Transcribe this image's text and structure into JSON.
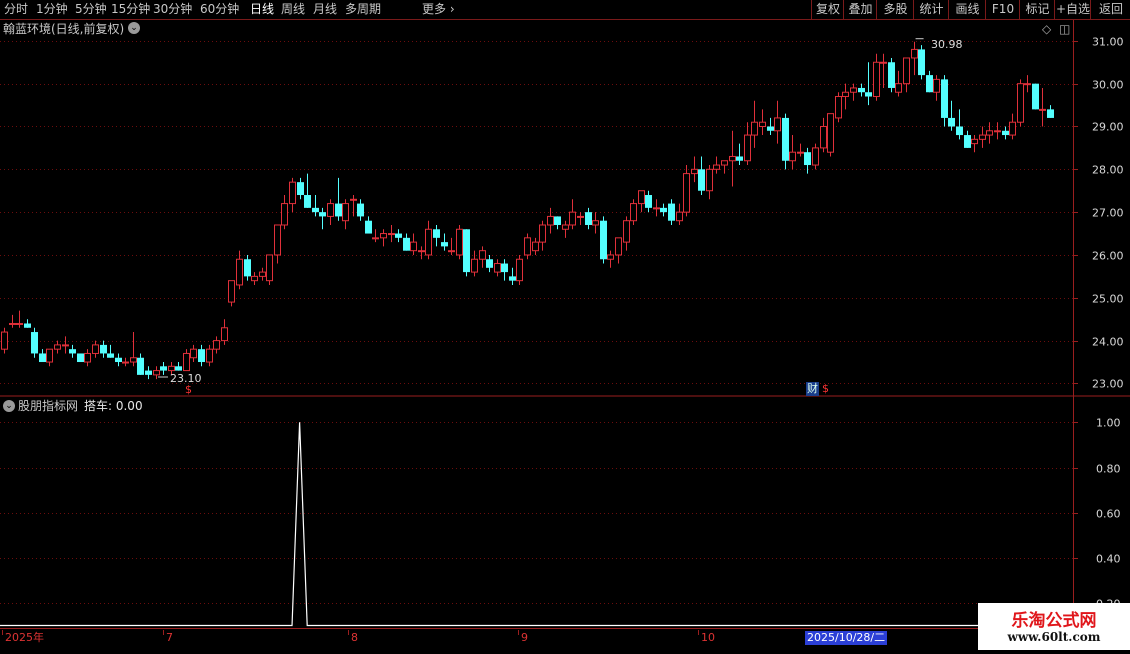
{
  "toolbar": {
    "periods": [
      "分时",
      "1分钟",
      "5分钟",
      "15分钟",
      "30分钟",
      "60分钟",
      "日线",
      "周线",
      "月线",
      "多周期"
    ],
    "active_period": "日线",
    "more_label": "更多",
    "right_buttons": [
      "复权",
      "叠加",
      "多股",
      "统计",
      "画线",
      "F10",
      "标记",
      "+自选",
      "返回"
    ]
  },
  "main_chart": {
    "title": "翰蓝环境(日线,前复权)",
    "high_label": "30.98",
    "low_label": "23.10",
    "event_marker_cai": "财",
    "event_marker_dollar": "$",
    "event_marker_dollar_left": "$"
  },
  "indicator": {
    "title": "股朋指标网",
    "value_text": "搭车: 0.00"
  },
  "time_axis": {
    "labels": [
      "2025年",
      "7",
      "8",
      "9",
      "10"
    ],
    "selected_date": "2025/10/28/二"
  },
  "watermark": {
    "line1": "乐淘公式网",
    "line2": "www.60lt.com"
  },
  "colors": {
    "up": "#e0303a",
    "down": "#54ffff",
    "grid": "#6b0d0d",
    "frame": "#9a1e1e",
    "axis_text": "#d8d8d8",
    "indicator_line": "#ffffff"
  },
  "chart_data": [
    {
      "type": "candlestick",
      "title": "翰蓝环境(日线,前复权)",
      "ylim": [
        22.8,
        31.3
      ],
      "y_ticks": [
        23.0,
        24.0,
        25.0,
        26.0,
        27.0,
        28.0,
        29.0,
        30.0,
        31.0
      ],
      "annotations": [
        {
          "label": "30.98",
          "kind": "high"
        },
        {
          "label": "23.10",
          "kind": "low"
        }
      ],
      "ohlc": [
        [
          23.8,
          24.3,
          23.7,
          24.2
        ],
        [
          24.4,
          24.6,
          24.3,
          24.4
        ],
        [
          24.4,
          24.7,
          24.3,
          24.4
        ],
        [
          24.4,
          24.5,
          24.3,
          24.3
        ],
        [
          24.2,
          24.3,
          23.6,
          23.7
        ],
        [
          23.7,
          23.8,
          23.5,
          23.5
        ],
        [
          23.5,
          23.8,
          23.4,
          23.8
        ],
        [
          23.8,
          24.0,
          23.7,
          23.9
        ],
        [
          23.9,
          24.1,
          23.7,
          23.9
        ],
        [
          23.8,
          23.9,
          23.6,
          23.7
        ],
        [
          23.7,
          23.7,
          23.5,
          23.5
        ],
        [
          23.5,
          23.8,
          23.4,
          23.7
        ],
        [
          23.7,
          24.0,
          23.6,
          23.9
        ],
        [
          23.9,
          24.0,
          23.6,
          23.7
        ],
        [
          23.7,
          23.9,
          23.6,
          23.6
        ],
        [
          23.6,
          23.7,
          23.4,
          23.5
        ],
        [
          23.5,
          23.6,
          23.4,
          23.5
        ],
        [
          23.5,
          24.2,
          23.4,
          23.6
        ],
        [
          23.6,
          23.7,
          23.2,
          23.2
        ],
        [
          23.3,
          23.4,
          23.1,
          23.2
        ],
        [
          23.2,
          23.4,
          23.1,
          23.3
        ],
        [
          23.4,
          23.5,
          23.2,
          23.3
        ],
        [
          23.3,
          23.5,
          23.2,
          23.4
        ],
        [
          23.4,
          23.5,
          23.3,
          23.3
        ],
        [
          23.3,
          23.8,
          23.3,
          23.7
        ],
        [
          23.6,
          23.9,
          23.5,
          23.8
        ],
        [
          23.8,
          23.9,
          23.4,
          23.5
        ],
        [
          23.5,
          23.9,
          23.4,
          23.8
        ],
        [
          23.8,
          24.1,
          23.7,
          24.0
        ],
        [
          24.0,
          24.5,
          23.9,
          24.3
        ],
        [
          24.9,
          25.4,
          24.8,
          25.4
        ],
        [
          25.3,
          26.1,
          25.2,
          25.9
        ],
        [
          25.9,
          26.0,
          25.4,
          25.5
        ],
        [
          25.4,
          25.6,
          25.3,
          25.5
        ],
        [
          25.5,
          25.7,
          25.4,
          25.6
        ],
        [
          25.4,
          26.0,
          25.3,
          26.0
        ],
        [
          26.0,
          26.7,
          25.8,
          26.7
        ],
        [
          26.7,
          27.4,
          26.6,
          27.2
        ],
        [
          27.2,
          27.8,
          27.0,
          27.7
        ],
        [
          27.7,
          27.8,
          27.3,
          27.4
        ],
        [
          27.4,
          27.9,
          27.1,
          27.1
        ],
        [
          27.1,
          27.4,
          26.9,
          27.0
        ],
        [
          27.0,
          27.1,
          26.6,
          26.9
        ],
        [
          26.9,
          27.3,
          26.7,
          27.2
        ],
        [
          27.2,
          27.8,
          26.8,
          26.9
        ],
        [
          26.8,
          27.3,
          26.6,
          27.2
        ],
        [
          27.3,
          27.4,
          26.9,
          27.3
        ],
        [
          27.2,
          27.3,
          26.8,
          26.9
        ],
        [
          26.8,
          26.9,
          26.5,
          26.5
        ],
        [
          26.4,
          26.6,
          26.3,
          26.4
        ],
        [
          26.4,
          26.6,
          26.2,
          26.5
        ],
        [
          26.5,
          26.7,
          26.3,
          26.5
        ],
        [
          26.5,
          26.6,
          26.3,
          26.4
        ],
        [
          26.4,
          26.5,
          26.1,
          26.1
        ],
        [
          26.1,
          26.5,
          26.0,
          26.3
        ],
        [
          26.1,
          26.2,
          25.9,
          26.1
        ],
        [
          26.0,
          26.8,
          25.9,
          26.6
        ],
        [
          26.6,
          26.7,
          26.2,
          26.4
        ],
        [
          26.3,
          26.5,
          26.1,
          26.2
        ],
        [
          26.1,
          26.4,
          26.0,
          26.1
        ],
        [
          26.0,
          26.7,
          25.9,
          26.6
        ],
        [
          26.6,
          26.6,
          25.5,
          25.6
        ],
        [
          25.6,
          26.1,
          25.5,
          25.9
        ],
        [
          25.9,
          26.2,
          25.7,
          26.1
        ],
        [
          25.9,
          26.0,
          25.6,
          25.7
        ],
        [
          25.6,
          25.9,
          25.5,
          25.8
        ],
        [
          25.8,
          25.9,
          25.4,
          25.6
        ],
        [
          25.5,
          25.7,
          25.3,
          25.4
        ],
        [
          25.4,
          26.0,
          25.3,
          25.9
        ],
        [
          26.0,
          26.5,
          25.9,
          26.4
        ],
        [
          26.1,
          26.4,
          26.0,
          26.3
        ],
        [
          26.3,
          26.8,
          26.1,
          26.7
        ],
        [
          26.7,
          27.1,
          26.5,
          26.9
        ],
        [
          26.9,
          26.9,
          26.6,
          26.7
        ],
        [
          26.6,
          26.8,
          26.4,
          26.7
        ],
        [
          26.7,
          27.3,
          26.6,
          27.0
        ],
        [
          26.9,
          27.0,
          26.7,
          26.9
        ],
        [
          27.0,
          27.1,
          26.6,
          26.7
        ],
        [
          26.7,
          27.0,
          26.5,
          26.8
        ],
        [
          26.8,
          26.9,
          25.8,
          25.9
        ],
        [
          25.9,
          26.1,
          25.7,
          26.0
        ],
        [
          26.0,
          26.4,
          25.8,
          26.4
        ],
        [
          26.3,
          26.9,
          26.1,
          26.8
        ],
        [
          26.8,
          27.3,
          26.7,
          27.2
        ],
        [
          27.2,
          27.5,
          27.0,
          27.5
        ],
        [
          27.4,
          27.5,
          27.0,
          27.1
        ],
        [
          27.1,
          27.3,
          26.9,
          27.1
        ],
        [
          27.1,
          27.2,
          26.9,
          27.0
        ],
        [
          27.2,
          27.3,
          26.7,
          26.8
        ],
        [
          26.8,
          27.2,
          26.7,
          27.0
        ],
        [
          27.0,
          28.1,
          26.9,
          27.9
        ],
        [
          27.9,
          28.3,
          27.7,
          28.0
        ],
        [
          28.0,
          28.3,
          27.4,
          27.5
        ],
        [
          27.5,
          28.1,
          27.3,
          28.0
        ],
        [
          28.0,
          28.3,
          27.9,
          28.1
        ],
        [
          28.1,
          28.2,
          27.9,
          28.2
        ],
        [
          28.2,
          28.9,
          27.6,
          28.3
        ],
        [
          28.3,
          28.6,
          28.1,
          28.2
        ],
        [
          28.2,
          29.1,
          28.1,
          28.8
        ],
        [
          28.8,
          29.6,
          28.5,
          29.1
        ],
        [
          29.0,
          29.4,
          28.8,
          29.1
        ],
        [
          29.0,
          29.2,
          28.8,
          28.9
        ],
        [
          28.9,
          29.6,
          28.6,
          29.2
        ],
        [
          29.2,
          29.3,
          28.0,
          28.2
        ],
        [
          28.2,
          28.8,
          28.0,
          28.4
        ],
        [
          28.4,
          28.6,
          28.3,
          28.4
        ],
        [
          28.4,
          28.5,
          27.9,
          28.1
        ],
        [
          28.1,
          28.6,
          28.0,
          28.5
        ],
        [
          28.5,
          29.2,
          28.4,
          29.0
        ],
        [
          28.4,
          29.3,
          28.3,
          29.3
        ],
        [
          29.2,
          29.8,
          29.1,
          29.7
        ],
        [
          29.7,
          30.0,
          29.4,
          29.8
        ],
        [
          29.8,
          30.0,
          29.6,
          29.9
        ],
        [
          29.9,
          30.0,
          29.7,
          29.8
        ],
        [
          29.8,
          30.5,
          29.5,
          29.7
        ],
        [
          29.7,
          30.7,
          29.6,
          30.5
        ],
        [
          30.5,
          30.7,
          29.9,
          30.5
        ],
        [
          30.5,
          30.6,
          29.8,
          29.9
        ],
        [
          29.8,
          30.3,
          29.7,
          30.0
        ],
        [
          30.0,
          30.6,
          29.8,
          30.6
        ],
        [
          30.6,
          30.98,
          30.2,
          30.8
        ],
        [
          30.8,
          30.9,
          30.1,
          30.2
        ],
        [
          30.2,
          30.3,
          29.8,
          29.8
        ],
        [
          29.8,
          30.2,
          29.6,
          30.1
        ],
        [
          30.1,
          30.2,
          29.0,
          29.2
        ],
        [
          29.2,
          29.6,
          28.9,
          29.0
        ],
        [
          29.0,
          29.4,
          28.7,
          28.8
        ],
        [
          28.8,
          28.9,
          28.5,
          28.5
        ],
        [
          28.6,
          28.8,
          28.4,
          28.7
        ],
        [
          28.7,
          29.0,
          28.5,
          28.8
        ],
        [
          28.8,
          29.1,
          28.6,
          28.9
        ],
        [
          28.9,
          29.1,
          28.7,
          28.9
        ],
        [
          28.9,
          29.0,
          28.7,
          28.8
        ],
        [
          28.8,
          29.3,
          28.7,
          29.1
        ],
        [
          29.1,
          30.1,
          29.0,
          30.0
        ],
        [
          30.0,
          30.2,
          29.8,
          30.0
        ],
        [
          30.0,
          30.0,
          29.4,
          29.4
        ],
        [
          29.4,
          29.9,
          29.0,
          29.4
        ],
        [
          29.4,
          29.5,
          29.2,
          29.2
        ]
      ]
    },
    {
      "type": "line",
      "title": "股朋指标网",
      "series": [
        {
          "name": "搭车",
          "spike_index": 39,
          "spike_value": 1.0,
          "baseline": 0.0
        }
      ],
      "ylim": [
        0.1,
        1.05
      ],
      "y_ticks": [
        1.0,
        0.8,
        0.6,
        0.4,
        0.2
      ]
    }
  ]
}
